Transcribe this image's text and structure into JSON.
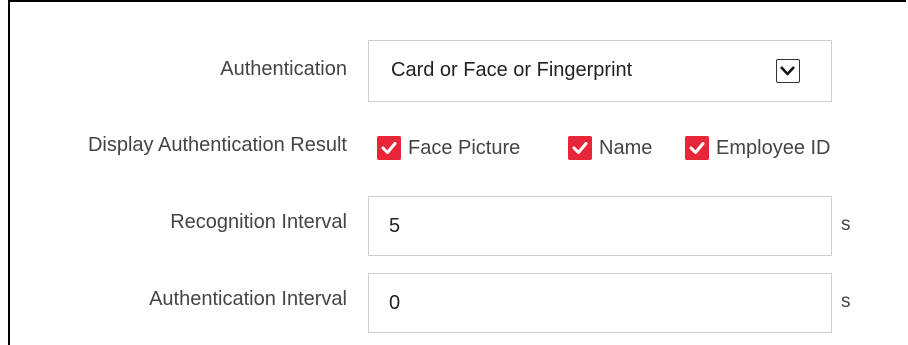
{
  "form": {
    "authentication": {
      "label": "Authentication",
      "selected": "Card or Face or Fingerprint"
    },
    "display_result": {
      "label": "Display Authentication Result",
      "options": [
        {
          "label": "Face Picture",
          "checked": true
        },
        {
          "label": "Name",
          "checked": true
        },
        {
          "label": "Employee ID",
          "checked": true
        }
      ]
    },
    "recognition_interval": {
      "label": "Recognition Interval",
      "value": "5",
      "unit": "s"
    },
    "authentication_interval": {
      "label": "Authentication Interval",
      "value": "0",
      "unit": "s"
    }
  },
  "colors": {
    "checkbox": "#e8263a",
    "label_text": "#444444",
    "border": "#cfcfcf"
  },
  "icons": {
    "dropdown": "chevron-down-icon",
    "check": "checkmark-icon"
  }
}
